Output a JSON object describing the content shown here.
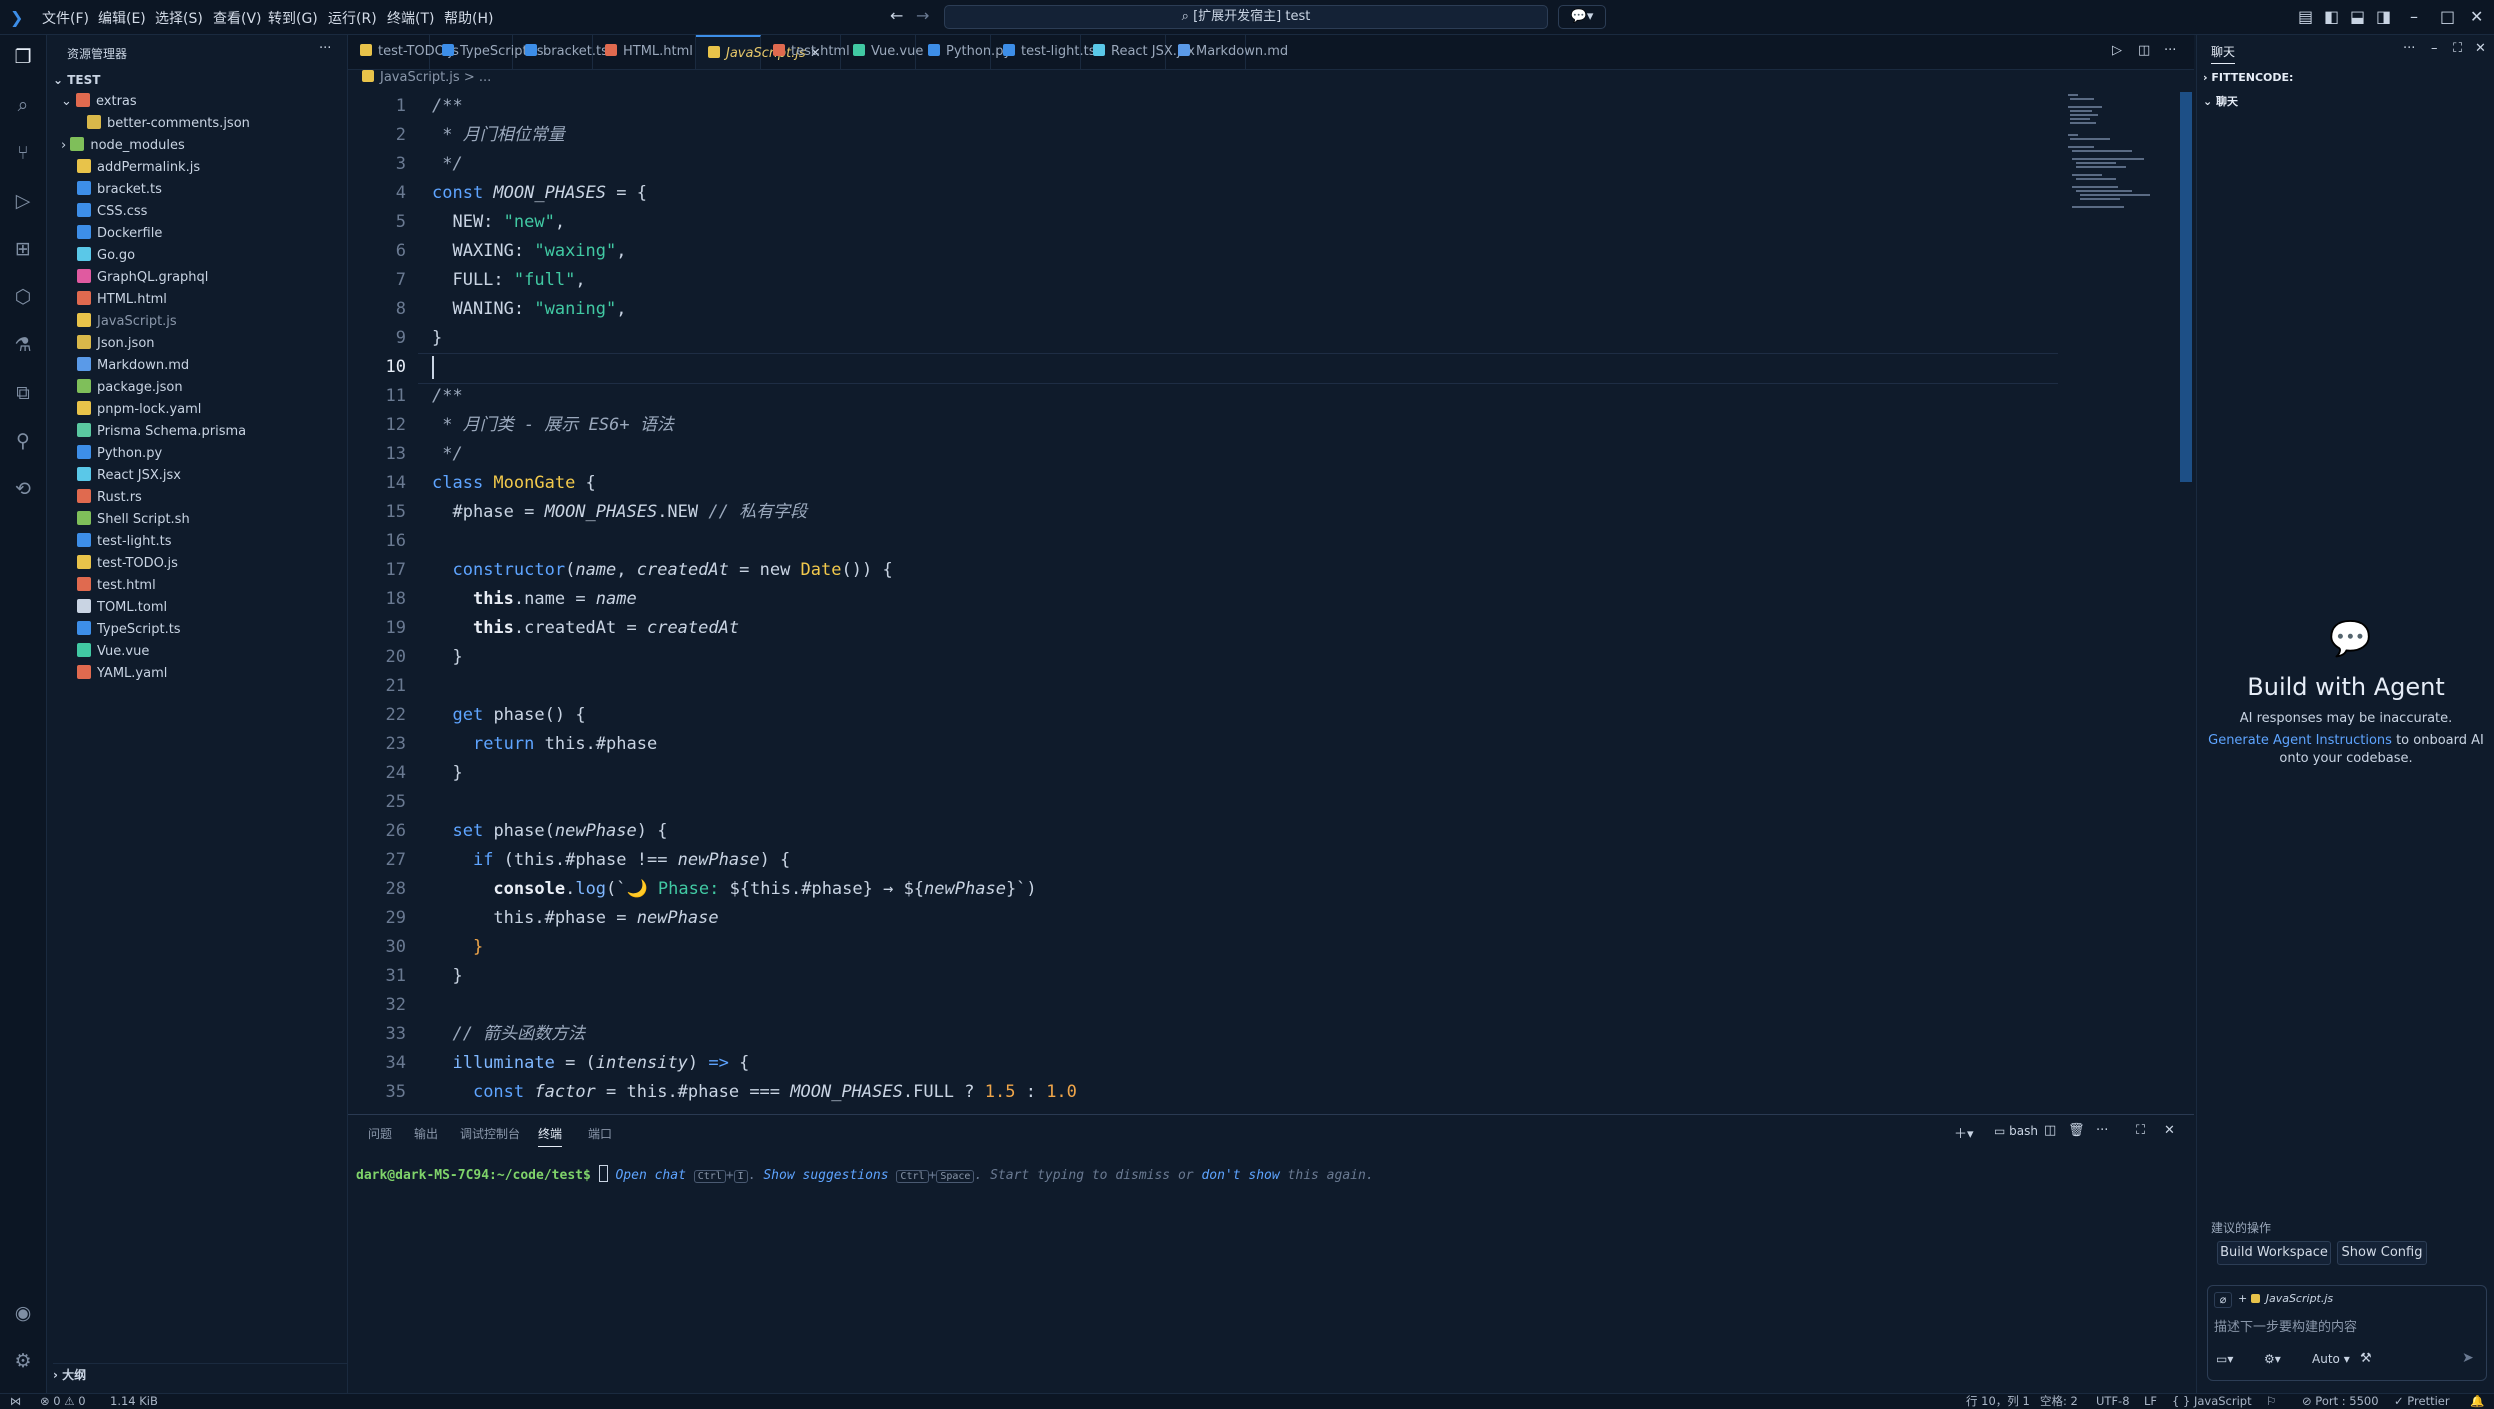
{
  "titlebar": {
    "menus": [
      "文件(F)",
      "编辑(E)",
      "选择(S)",
      "查看(V)",
      "转到(G)",
      "运行(R)",
      "终端(T)",
      "帮助(H)"
    ],
    "search": "[扩展开发宿主] test"
  },
  "sidebar": {
    "title": "资源管理器",
    "root": "TEST",
    "tree": [
      {
        "label": "extras",
        "kind": "folder-open",
        "depth": 1,
        "color": "#e06a4f"
      },
      {
        "label": "better-comments.json",
        "kind": "file",
        "depth": 2,
        "color": "#d9b84a"
      },
      {
        "label": "node_modules",
        "kind": "folder",
        "depth": 1,
        "color": "#7fbf5a"
      },
      {
        "label": "addPermalink.js",
        "kind": "file",
        "depth": 1,
        "color": "#e8c34a"
      },
      {
        "label": "bracket.ts",
        "kind": "file",
        "depth": 1,
        "color": "#3d8ee8"
      },
      {
        "label": "CSS.css",
        "kind": "file",
        "depth": 1,
        "color": "#3d8ee8"
      },
      {
        "label": "Dockerfile",
        "kind": "file",
        "depth": 1,
        "color": "#3d8ee8"
      },
      {
        "label": "Go.go",
        "kind": "file",
        "depth": 1,
        "color": "#5ac8e8"
      },
      {
        "label": "GraphQL.graphql",
        "kind": "file",
        "depth": 1,
        "color": "#e05aa0"
      },
      {
        "label": "HTML.html",
        "kind": "file",
        "depth": 1,
        "color": "#e06a4f"
      },
      {
        "label": "JavaScript.js",
        "kind": "file",
        "depth": 1,
        "color": "#e8c34a"
      },
      {
        "label": "Json.json",
        "kind": "file",
        "depth": 1,
        "color": "#d9b84a"
      },
      {
        "label": "Markdown.md",
        "kind": "file",
        "depth": 1,
        "color": "#5a9ae8"
      },
      {
        "label": "package.json",
        "kind": "file",
        "depth": 1,
        "color": "#7fbf5a"
      },
      {
        "label": "pnpm-lock.yaml",
        "kind": "file",
        "depth": 1,
        "color": "#e8c34a"
      },
      {
        "label": "Prisma Schema.prisma",
        "kind": "file",
        "depth": 1,
        "color": "#5ac8a0"
      },
      {
        "label": "Python.py",
        "kind": "file",
        "depth": 1,
        "color": "#3d8ee8"
      },
      {
        "label": "React JSX.jsx",
        "kind": "file",
        "depth": 1,
        "color": "#5ac8e8"
      },
      {
        "label": "Rust.rs",
        "kind": "file",
        "depth": 1,
        "color": "#e06a4f"
      },
      {
        "label": "Shell Script.sh",
        "kind": "file",
        "depth": 1,
        "color": "#7fbf5a"
      },
      {
        "label": "test-light.ts",
        "kind": "file",
        "depth": 1,
        "color": "#3d8ee8"
      },
      {
        "label": "test-TODO.js",
        "kind": "file",
        "depth": 1,
        "color": "#e8c34a"
      },
      {
        "label": "test.html",
        "kind": "file",
        "depth": 1,
        "color": "#e06a4f"
      },
      {
        "label": "TOML.toml",
        "kind": "file",
        "depth": 1,
        "color": "#c9d4e3"
      },
      {
        "label": "TypeScript.ts",
        "kind": "file",
        "depth": 1,
        "color": "#3d8ee8"
      },
      {
        "label": "Vue.vue",
        "kind": "file",
        "depth": 1,
        "color": "#41c9a3"
      },
      {
        "label": "YAML.yaml",
        "kind": "file",
        "depth": 1,
        "color": "#e06a4f"
      }
    ],
    "outline": "大纲"
  },
  "tabs": [
    {
      "label": "test-TODO.js",
      "color": "#e8c34a"
    },
    {
      "label": "TypeScript.ts",
      "color": "#3d8ee8"
    },
    {
      "label": "bracket.ts",
      "color": "#3d8ee8"
    },
    {
      "label": "HTML.html",
      "color": "#e06a4f"
    },
    {
      "label": "JavaScript.js",
      "color": "#e8c34a",
      "active": true
    },
    {
      "label": "test.html",
      "color": "#e06a4f"
    },
    {
      "label": "Vue.vue",
      "color": "#41c9a3"
    },
    {
      "label": "Python.py",
      "color": "#3d8ee8"
    },
    {
      "label": "test-light.ts",
      "color": "#3d8ee8"
    },
    {
      "label": "React JSX.jsx",
      "color": "#5ac8e8"
    },
    {
      "label": "Markdown.md",
      "color": "#5a9ae8"
    }
  ],
  "breadcrumb": "JavaScript.js > ...",
  "code_lines": [
    [
      [
        "cmt",
        "/**"
      ]
    ],
    [
      [
        "cmt",
        " * 月门相位常量"
      ]
    ],
    [
      [
        "cmt",
        " */"
      ]
    ],
    [
      [
        "kw",
        "const "
      ],
      [
        "var",
        "MOON_PHASES"
      ],
      [
        "plain",
        " = {"
      ]
    ],
    [
      [
        "plain",
        "  NEW: "
      ],
      [
        "str",
        "\"new\""
      ],
      [
        "plain",
        ","
      ]
    ],
    [
      [
        "plain",
        "  WAXING: "
      ],
      [
        "str",
        "\"waxing\""
      ],
      [
        "plain",
        ","
      ]
    ],
    [
      [
        "plain",
        "  FULL: "
      ],
      [
        "str",
        "\"full\""
      ],
      [
        "plain",
        ","
      ]
    ],
    [
      [
        "plain",
        "  WANING: "
      ],
      [
        "str",
        "\"waning\""
      ],
      [
        "plain",
        ","
      ]
    ],
    [
      [
        "plain",
        "}"
      ]
    ],
    [],
    [
      [
        "cmt",
        "/**"
      ]
    ],
    [
      [
        "cmt",
        " * 月门类 - 展示 ES6+ 语法"
      ]
    ],
    [
      [
        "cmt",
        " */"
      ]
    ],
    [
      [
        "kw",
        "class "
      ],
      [
        "cls",
        "MoonGate"
      ],
      [
        "plain",
        " {"
      ]
    ],
    [
      [
        "plain",
        "  #phase = "
      ],
      [
        "var",
        "MOON_PHASES"
      ],
      [
        "plain",
        ".NEW "
      ],
      [
        "cmt",
        "// 私有字段"
      ]
    ],
    [],
    [
      [
        "plain",
        "  "
      ],
      [
        "kw",
        "constructor"
      ],
      [
        "plain",
        "("
      ],
      [
        "var",
        "name"
      ],
      [
        "plain",
        ", "
      ],
      [
        "var",
        "createdAt"
      ],
      [
        "plain",
        " = new "
      ],
      [
        "cls",
        "Date"
      ],
      [
        "plain",
        "()) {"
      ]
    ],
    [
      [
        "plain",
        "    "
      ],
      [
        "bold",
        "this"
      ],
      [
        "plain",
        ".name = "
      ],
      [
        "var",
        "name"
      ]
    ],
    [
      [
        "plain",
        "    "
      ],
      [
        "bold",
        "this"
      ],
      [
        "plain",
        ".createdAt = "
      ],
      [
        "var",
        "createdAt"
      ]
    ],
    [
      [
        "plain",
        "  }"
      ]
    ],
    [],
    [
      [
        "plain",
        "  "
      ],
      [
        "kw",
        "get "
      ],
      [
        "plain",
        "phase() {"
      ]
    ],
    [
      [
        "plain",
        "    "
      ],
      [
        "kw",
        "return "
      ],
      [
        "plain",
        "this.#phase"
      ]
    ],
    [
      [
        "plain",
        "  }"
      ]
    ],
    [],
    [
      [
        "plain",
        "  "
      ],
      [
        "kw",
        "set "
      ],
      [
        "plain",
        "phase("
      ],
      [
        "var",
        "newPhase"
      ],
      [
        "plain",
        ") {"
      ]
    ],
    [
      [
        "plain",
        "    "
      ],
      [
        "kw",
        "if "
      ],
      [
        "plain",
        "(this.#phase !== "
      ],
      [
        "var",
        "newPhase"
      ],
      [
        "plain",
        ") {"
      ]
    ],
    [
      [
        "plain",
        "      "
      ],
      [
        "bold",
        "console"
      ],
      [
        "plain",
        "."
      ],
      [
        "fn",
        "log"
      ],
      [
        "plain",
        "(`🌙 "
      ],
      [
        "str",
        "Phase: "
      ],
      [
        "plain",
        "${this.#phase} → ${"
      ],
      [
        "var",
        "newPhase"
      ],
      [
        "plain",
        "}`)"
      ]
    ],
    [
      [
        "plain",
        "      this.#phase = "
      ],
      [
        "var",
        "newPhase"
      ]
    ],
    [
      [
        "num",
        "    }"
      ]
    ],
    [
      [
        "plain",
        "  }"
      ]
    ],
    [],
    [
      [
        "cmt",
        "  // 箭头函数方法"
      ]
    ],
    [
      [
        "plain",
        "  "
      ],
      [
        "fn",
        "illuminate"
      ],
      [
        "plain",
        " = ("
      ],
      [
        "var",
        "intensity"
      ],
      [
        "plain",
        ") "
      ],
      [
        "kw",
        "=>"
      ],
      [
        "plain",
        " {"
      ]
    ],
    [
      [
        "plain",
        "    "
      ],
      [
        "kw",
        "const "
      ],
      [
        "var",
        "factor"
      ],
      [
        "plain",
        " = this.#phase === "
      ],
      [
        "var",
        "MOON_PHASES"
      ],
      [
        "plain",
        ".FULL ? "
      ],
      [
        "num",
        "1.5"
      ],
      [
        "plain",
        " : "
      ],
      [
        "num",
        "1.0"
      ]
    ]
  ],
  "line_numbers": [
    "1",
    "2",
    "3",
    "4",
    "5",
    "6",
    "7",
    "8",
    "9",
    "10",
    "11",
    "12",
    "13",
    "14",
    "15",
    "16",
    "17",
    "18",
    "19",
    "20",
    "21",
    "22",
    "23",
    "24",
    "25",
    "26",
    "27",
    "28",
    "29",
    "30",
    "31",
    "32",
    "33",
    "34",
    "35"
  ],
  "panel": {
    "tabs": [
      "问题",
      "输出",
      "调试控制台",
      "终端",
      "端口"
    ],
    "active_tab": "终端",
    "shell": "bash",
    "prompt": "dark@dark-MS-7C94:~/code/test$",
    "hint_open_chat": "Open chat",
    "hint_key1": "Ctrl",
    "hint_key2": "I",
    "hint_show": "Show suggestions",
    "hint_key3": "Ctrl",
    "hint_key4": "Space",
    "hint_rest": ". Start typing to dismiss or",
    "hint_dont": "don't show",
    "hint_end": "this again."
  },
  "chat": {
    "title": "聊天",
    "section1": "FITTENCODE:",
    "section2": "聊天",
    "heading": "Build with Agent",
    "note": "AI responses may be inaccurate.",
    "link": "Generate Agent Instructions",
    "link_after": "to onboard AI",
    "link_line2": "onto your codebase.",
    "suggest_label": "建议的操作",
    "btn_build": "Build Workspace",
    "btn_config": "Show Config",
    "context_file": "JavaScript.js",
    "input_placeholder": "描述下一步要构建的内容",
    "mode": "Auto"
  },
  "status": {
    "errors": "0",
    "warnings": "0",
    "size": "1.14 KiB",
    "position": "行 10，列 1",
    "spaces": "空格: 2",
    "encoding": "UTF-8",
    "eol": "LF",
    "language": "JavaScript",
    "port": "Port : 5500",
    "prettier": "Prettier"
  },
  "colors": {
    "accent": "#3d8ee8",
    "bg": "#0f1b2b"
  }
}
